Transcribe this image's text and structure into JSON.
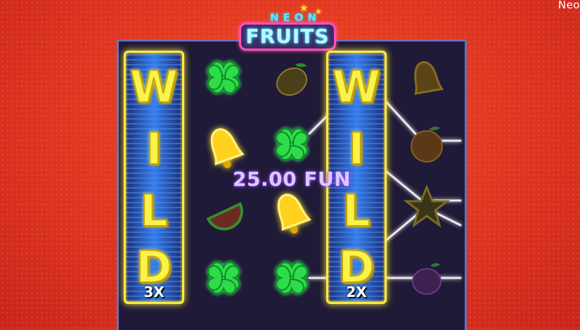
{
  "corner_label": "Neo",
  "logo": {
    "top_word": "NEON",
    "main_word": "FRUITS"
  },
  "reels": [
    {
      "type": "wild",
      "letters": [
        "W",
        "I",
        "L",
        "D"
      ],
      "multiplier": "3X"
    },
    {
      "type": "symbols",
      "symbols": [
        "clover-icon",
        "bell-icon",
        "melon-icon",
        "clover-icon"
      ]
    },
    {
      "type": "symbols",
      "symbols": [
        "lemon-icon",
        "clover-icon",
        "bell-icon",
        "clover-icon"
      ]
    },
    {
      "type": "wild",
      "letters": [
        "W",
        "I",
        "L",
        "D"
      ],
      "multiplier": "2X"
    },
    {
      "type": "symbols",
      "symbols": [
        "bell-icon",
        "orange-icon",
        "star-icon",
        "plum-icon"
      ]
    }
  ],
  "win": {
    "amount": "25.00 FUN"
  },
  "colors": {
    "background": "#e33a22",
    "board": "#1f1a37",
    "wild_frame": "#ffec3b",
    "win_lines": "#ffffff"
  }
}
